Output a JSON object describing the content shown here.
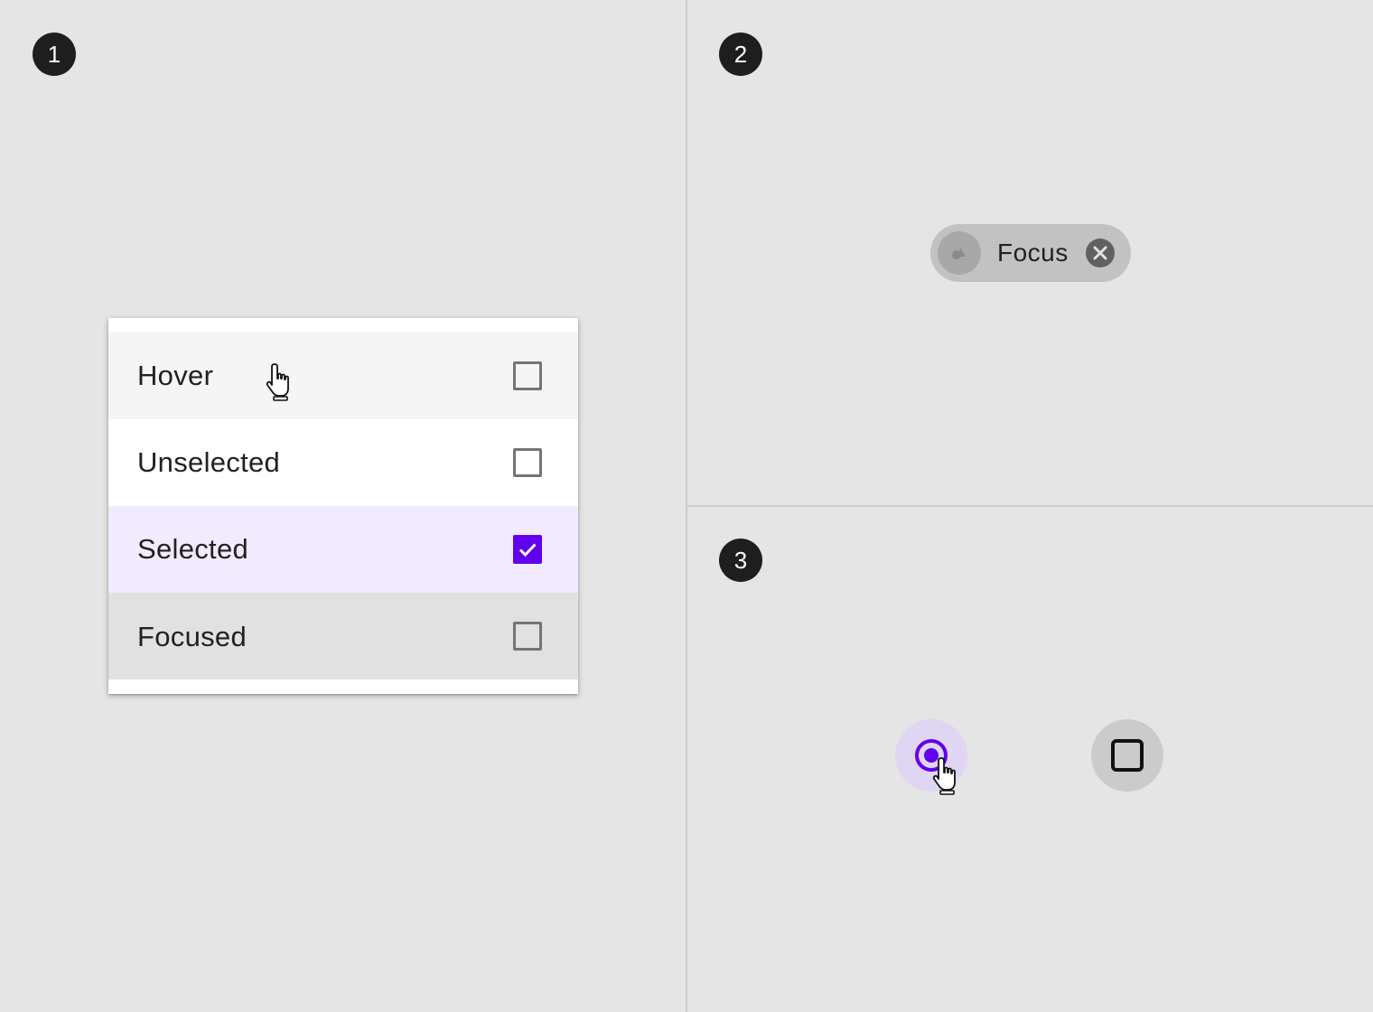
{
  "markers": [
    "1",
    "2",
    "3"
  ],
  "menu": {
    "items": [
      {
        "label": "Hover",
        "state": "hover",
        "checked": false
      },
      {
        "label": "Unselected",
        "state": "unselected",
        "checked": false
      },
      {
        "label": "Selected",
        "state": "selected",
        "checked": true
      },
      {
        "label": "Focused",
        "state": "focused",
        "checked": false
      }
    ]
  },
  "chip": {
    "label": "Focus",
    "avatar_icon": "avatar-icon",
    "close_icon": "close-icon"
  },
  "controls": {
    "radio_checked": true,
    "checkbox_checked": false
  },
  "colors": {
    "accent": "#6200ee",
    "selected_bg": "#f2eafe",
    "hover_bg": "#f5f5f5",
    "focused_bg": "#e1e1e1",
    "marker_bg": "#1e1e1e"
  }
}
